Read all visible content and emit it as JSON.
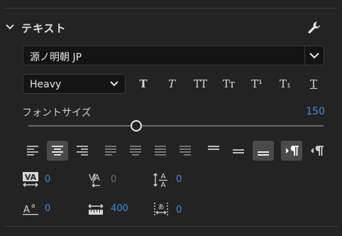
{
  "section": {
    "title": "テキスト"
  },
  "font": {
    "family": "源ノ明朝 JP",
    "style": "Heavy"
  },
  "style_buttons": [
    {
      "label": "T"
    },
    {
      "label": "T"
    },
    {
      "label": "TT"
    },
    {
      "label": "Tт"
    },
    {
      "label": "T¹"
    },
    {
      "label": "T₁"
    },
    {
      "label": "T"
    }
  ],
  "font_size": {
    "label": "フォントサイズ",
    "value": "150"
  },
  "properties": {
    "tracking": "0",
    "kerning": "0",
    "leading": "0",
    "baseline_shift": "0",
    "tsume": "400",
    "tab_width": "0"
  },
  "colors": {
    "accent": "#3d8be3",
    "panel": "#232323",
    "field": "#141414"
  }
}
